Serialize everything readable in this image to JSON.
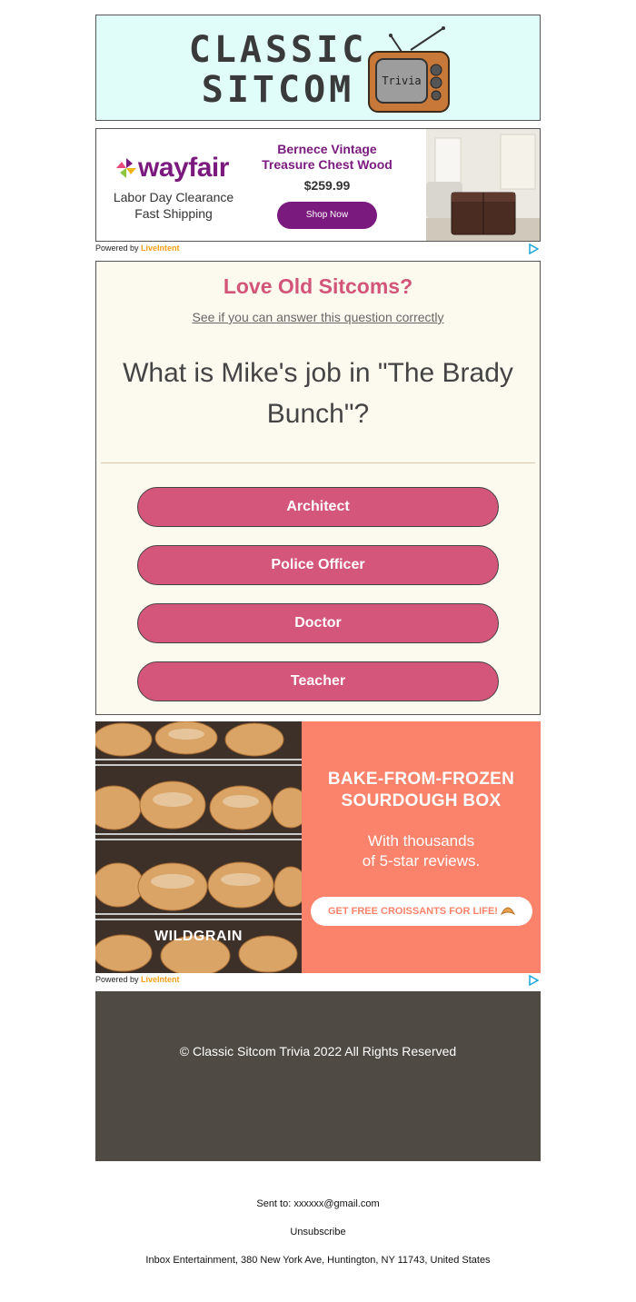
{
  "header": {
    "logo_line1": "CLASSIC",
    "logo_line2": "SITCOM",
    "tv_label": "Trivia",
    "bg_color": "#e0fdfa"
  },
  "ad_wayfair": {
    "brand": "wayfair",
    "tagline_line1": "Labor Day Clearance",
    "tagline_line2": "Fast Shipping",
    "product_line1": "Bernece Vintage",
    "product_line2": "Treasure Chest Wood",
    "price": "$259.99",
    "cta": "Shop Now",
    "brand_color": "#7b1a7e",
    "powered_by": "Powered by",
    "powered_brand": "LiveIntent"
  },
  "trivia": {
    "headline": "Love Old Sitcoms?",
    "subheadline": "See if you can answer this question correctly",
    "question": "What is Mike's job in \"The Brady Bunch\"?",
    "answers": [
      "Architect",
      "Police Officer",
      "Doctor",
      "Teacher"
    ],
    "accent_color": "#d4567a"
  },
  "ad_wildgrain": {
    "title_line1": "BAKE-FROM-FROZEN",
    "title_line2": "SOURDOUGH BOX",
    "body_line1": "With thousands",
    "body_line2": "of 5-star reviews.",
    "cta": "GET FREE CROISSANTS FOR LIFE!",
    "brand": "WILDGRAIN",
    "panel_color": "#fc836b",
    "powered_by": "Powered by",
    "powered_brand": "LiveIntent"
  },
  "footer": {
    "copyright": "© Classic Sitcom Trivia 2022 All Rights Reserved",
    "sent_to": "Sent to: xxxxxx@gmail.com",
    "unsubscribe": "Unsubscribe",
    "address": "Inbox Entertainment, 380 New York Ave, Huntington, NY 11743, United States",
    "bg_color": "#4f4a44"
  }
}
